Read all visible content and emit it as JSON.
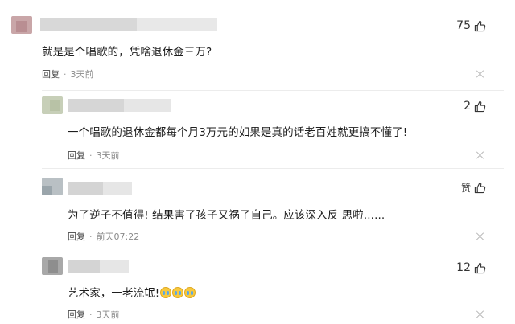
{
  "comments": [
    {
      "likes": "75",
      "text": "就是是个唱歌的，凭啥退休金三万?",
      "reply_label": "回复",
      "time": "3天前"
    },
    {
      "likes": "2",
      "text": "一个唱歌的退休金都每个月3万元的如果是真的话老百姓就更搞不懂了!",
      "reply_label": "回复",
      "time": "3天前"
    },
    {
      "likes": "赞",
      "text": "为了逆子不值得! 结果害了孩子又祸了自己。应该深入反 思啦......",
      "reply_label": "回复",
      "time": "前天07:22"
    },
    {
      "likes": "12",
      "text": "艺术家，一老流氓!",
      "reply_label": "回复",
      "time": "3天前"
    }
  ],
  "icons": {
    "like": "thumbs-up-icon",
    "close": "close-icon",
    "emoji": "crying-face-emoji"
  },
  "colors": {
    "text": "#1e1e1e",
    "meta": "#8a8a8a",
    "divider": "#ececec"
  }
}
